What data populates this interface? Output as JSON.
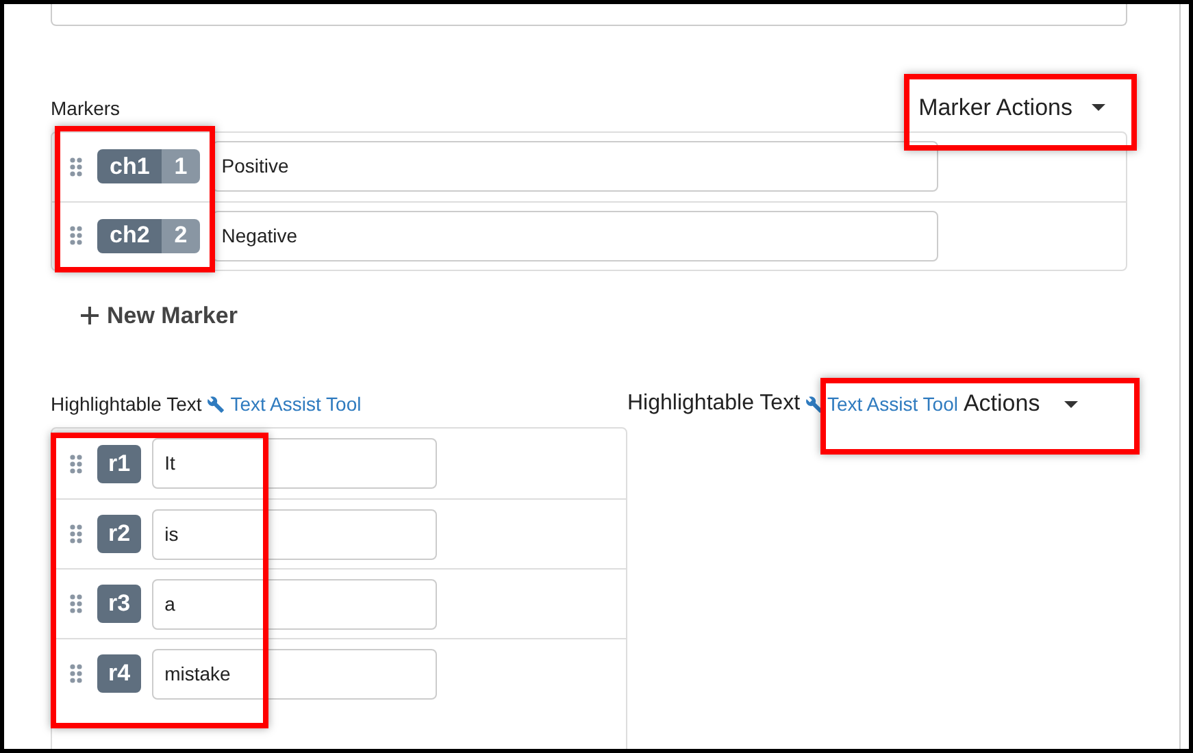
{
  "markers": {
    "title": "Markers",
    "actions_button": "Marker Actions",
    "add_button": "New Marker",
    "items": [
      {
        "code": "ch1",
        "key": "1",
        "value": "Positive"
      },
      {
        "code": "ch2",
        "key": "2",
        "value": "Negative"
      }
    ]
  },
  "highlightable": {
    "title": "Highlightable Text",
    "tool_link": "Text Assist Tool",
    "items": [
      {
        "code": "r1",
        "value": "It"
      },
      {
        "code": "r2",
        "value": "is"
      },
      {
        "code": "r3",
        "value": "a"
      },
      {
        "code": "r4",
        "value": "mistake"
      }
    ]
  },
  "highlightable_actions": {
    "title": "Highlightable Text",
    "tool_link": "Text Assist Tool",
    "button": "Actions"
  }
}
